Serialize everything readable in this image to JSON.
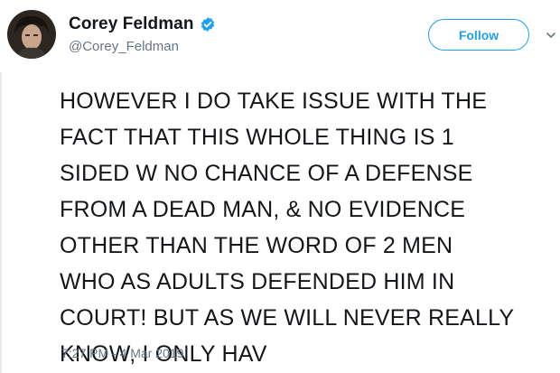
{
  "tweet": {
    "author": {
      "display_name": "Corey Feldman",
      "handle": "@Corey_Feldman",
      "verified": true,
      "avatar_icon": "profile-photo"
    },
    "follow_label": "Follow",
    "text": "HOWEVER I DO TAKE ISSUE WITH THE\nFACT THAT THIS WHOLE THING IS 1\nSIDED W NO CHANCE OF A DEFENSE\nFROM A DEAD MAN, & NO EVIDENCE\nOTHER THAN THE WORD OF 2 MEN\nWHO AS ADULTS DEFENDED HIM IN\nCOURT! BUT AS WE WILL NEVER REALLY\nKNOW, I ONLY HAV",
    "timestamp": "7:27 PM - 4 Mar 2019"
  },
  "colors": {
    "accent": "#1da1f2",
    "text": "#14171a",
    "secondary_text": "#657786"
  },
  "icons": [
    "verified-badge-icon",
    "chevron-down-icon"
  ]
}
